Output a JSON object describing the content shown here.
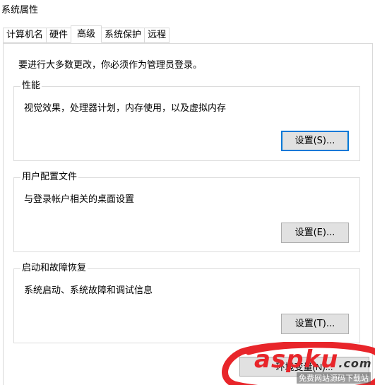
{
  "window": {
    "title": "系统属性"
  },
  "tabs": [
    {
      "label": "计算机名",
      "active": false
    },
    {
      "label": "硬件",
      "active": false
    },
    {
      "label": "高级",
      "active": true
    },
    {
      "label": "系统保护",
      "active": false
    },
    {
      "label": "远程",
      "active": false
    }
  ],
  "admin_note": "要进行大多数更改，你必须作为管理员登录。",
  "performance": {
    "title": "性能",
    "description": "视觉效果，处理器计划，内存使用，以及虚拟内存",
    "button": "设置(S)..."
  },
  "user_profiles": {
    "title": "用户配置文件",
    "description": "与登录帐户相关的桌面设置",
    "button": "设置(E)..."
  },
  "startup_recovery": {
    "title": "启动和故障恢复",
    "description": "系统启动、系统故障和调试信息",
    "button": "设置(T)..."
  },
  "env_button": {
    "label": "环境变量(N)..."
  },
  "watermark": {
    "brand_a": "asp",
    "brand_b": "ku",
    "brand_c": ".com",
    "tagline": "免费网站源码下载站"
  },
  "colors": {
    "focus_border": "#0078d7",
    "button_bg": "#e1e1e1",
    "annotation_red": "#e8252a"
  }
}
